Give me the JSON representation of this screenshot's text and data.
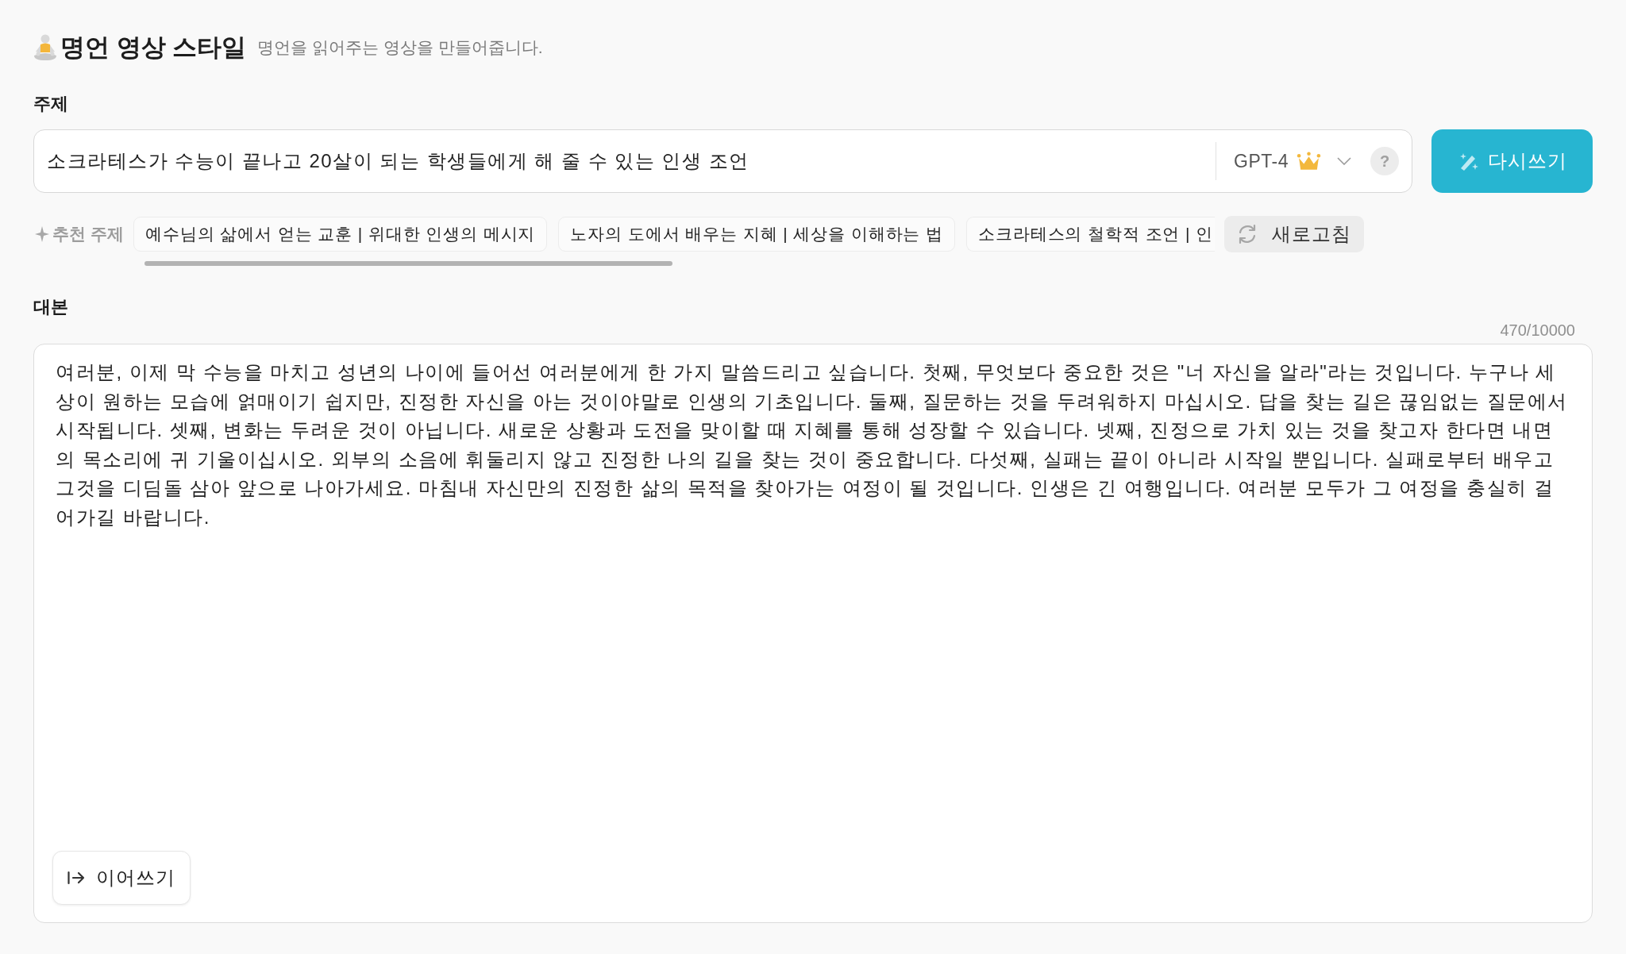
{
  "header": {
    "title": "명언 영상 스타일",
    "description": "명언을 읽어주는 영상을 만들어줍니다."
  },
  "topic": {
    "label": "주제",
    "value": "소크라테스가 수능이 끝나고 20살이 되는 학생들에게 해 줄 수 있는 인생 조언",
    "model": "GPT-4",
    "help": "?",
    "rewrite_button": "다시쓰기"
  },
  "suggestions": {
    "label": "추천 주제",
    "items": [
      "예수님의 삶에서 얻는 교훈 | 위대한 인생의 메시지",
      "노자의 도에서 배우는 지혜 | 세상을 이해하는 법",
      "소크라테스의 철학적 조언 | 인"
    ],
    "refresh_button": "새로고침"
  },
  "script": {
    "label": "대본",
    "char_count": "470/10000",
    "value": "여러분, 이제 막 수능을 마치고 성년의 나이에 들어선 여러분에게 한 가지 말씀드리고 싶습니다. 첫째, 무엇보다 중요한 것은 \"너 자신을 알라\"라는 것입니다. 누구나 세상이 원하는 모습에 얽매이기 쉽지만, 진정한 자신을 아는 것이야말로 인생의 기초입니다. 둘째, 질문하는 것을 두려워하지 마십시오. 답을 찾는 길은 끊임없는 질문에서 시작됩니다. 셋째, 변화는 두려운 것이 아닙니다. 새로운 상황과 도전을 맞이할 때 지혜를 통해 성장할 수 있습니다. 넷째, 진정으로 가치 있는 것을 찾고자 한다면 내면의 목소리에 귀 기울이십시오. 외부의 소음에 휘둘리지 않고 진정한 나의 길을 찾는 것이 중요합니다. 다섯째, 실패는 끝이 아니라 시작일 뿐입니다. 실패로부터 배우고 그것을 디딤돌 삼아 앞으로 나아가세요. 마침내 자신만의 진정한 삶의 목적을 찾아가는 여정이 될 것입니다. 인생은 긴 여행입니다. 여러분 모두가 그 여정을 충실히 걸어가길 바랍니다.",
    "continue_button": "이어쓰기"
  }
}
